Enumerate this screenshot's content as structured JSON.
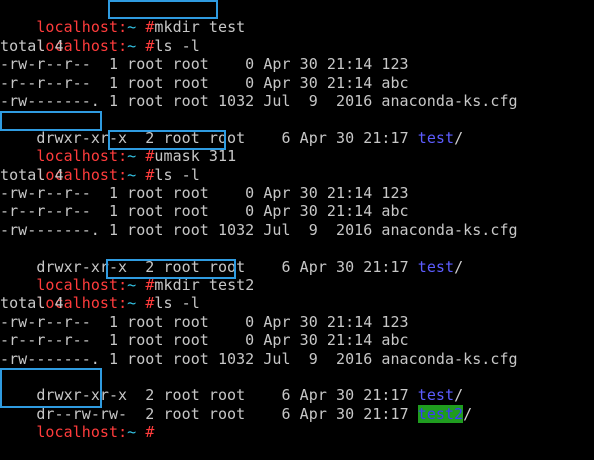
{
  "colors": {
    "background": "#000000",
    "text": "#c7c7c7",
    "host": "#ff3c3c",
    "tilde": "#34c6e8",
    "directory": "#5c5cff",
    "sticky_dir_bg": "#1f9c1f",
    "highlight_box": "#2f9be0"
  },
  "prompt": {
    "host": "localhost",
    "sep": ":",
    "path": "~",
    "symbol": " #"
  },
  "lines": {
    "l1": {
      "cmd": "mkdir test"
    },
    "l2": {
      "cmd": "ls -l"
    },
    "l3": {
      "text": "total 4"
    },
    "l4": {
      "text": "-rw-r--r--  1 root root    0 Apr 30 21:14 123"
    },
    "l5": {
      "text": "-r--r--r--  1 root root    0 Apr 30 21:14 abc"
    },
    "l6": {
      "text": "-rw-------. 1 root root 1032 Jul  9  2016 anaconda-ks.cfg"
    },
    "l7": {
      "perm": "drwxr-xr-x",
      "rest": "  2 root root    6 Apr 30 21:17 ",
      "name": "test",
      "slash": "/"
    },
    "l8": {
      "cmd": "umask 311"
    },
    "l9": {
      "cmd": "ls -l"
    },
    "l10": {
      "text": "total 4"
    },
    "l11": {
      "text": "-rw-r--r--  1 root root    0 Apr 30 21:14 123"
    },
    "l12": {
      "text": "-r--r--r--  1 root root    0 Apr 30 21:14 abc"
    },
    "l13": {
      "text": "-rw-------. 1 root root 1032 Jul  9  2016 anaconda-ks.cfg"
    },
    "l14": {
      "perm": "drwxr-xr-x",
      "rest": "  2 root root    6 Apr 30 21:17 ",
      "name": "test",
      "slash": "/"
    },
    "l15": {
      "cmd": "mkdir test2"
    },
    "l16": {
      "cmd": "ls -l"
    },
    "l17": {
      "text": "total 4"
    },
    "l18": {
      "text": "-rw-r--r--  1 root root    0 Apr 30 21:14 123"
    },
    "l19": {
      "text": "-r--r--r--  1 root root    0 Apr 30 21:14 abc"
    },
    "l20": {
      "text": "-rw-------. 1 root root 1032 Jul  9  2016 anaconda-ks.cfg"
    },
    "l21": {
      "perm": "drwxr-xr-x",
      "rest": "  2 root root    6 Apr 30 21:17 ",
      "name": "test",
      "slash": "/"
    },
    "l22": {
      "perm": "dr--rw-rw-",
      "rest": "  2 root root    6 Apr 30 21:17 ",
      "name": "test2",
      "slash": "/"
    },
    "l23": {
      "cmd": ""
    }
  }
}
